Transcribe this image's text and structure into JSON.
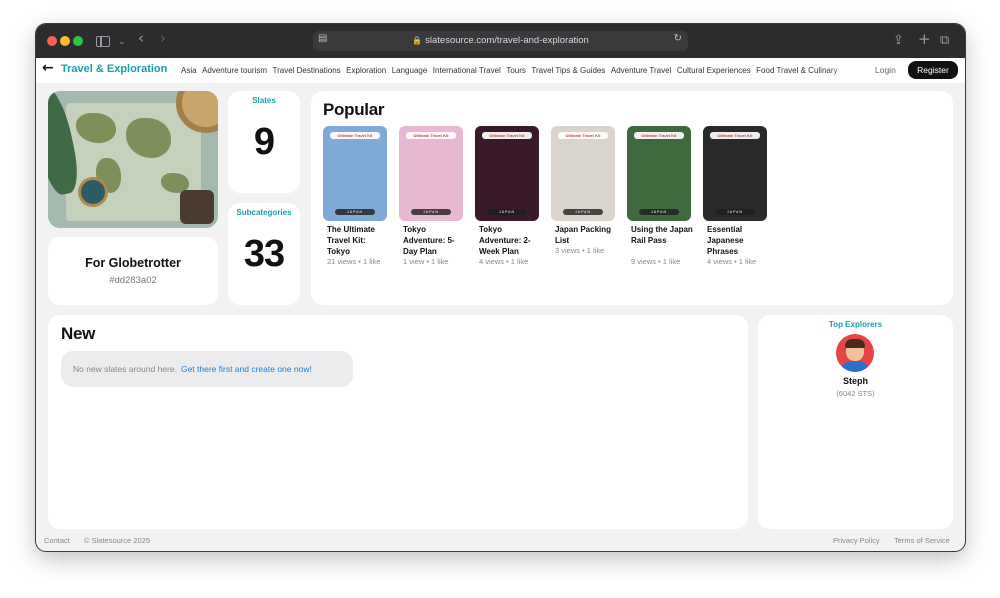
{
  "browser": {
    "url": "slatesource.com/travel-and-exploration"
  },
  "header": {
    "title": "Travel & Exploration",
    "subcategories": [
      "Asia",
      "Adventure tourism",
      "Travel Destinations",
      "Exploration",
      "Language",
      "International Travel",
      "Tours",
      "Travel Tips & Guides",
      "Adventure Travel",
      "Cultural Experiences",
      "Food Travel & Culinary"
    ],
    "login_label": "Login",
    "register_label": "Register"
  },
  "profile": {
    "name": "For Globetrotter",
    "code": "#dd283a02"
  },
  "stats": {
    "slates_label": "Slates",
    "slates_value": "9",
    "subcategories_label": "Subcategories",
    "subcategories_value": "33"
  },
  "popular": {
    "title": "Popular",
    "items": [
      {
        "title": "The Ultimate Travel Kit: Tokyo",
        "meta": "21 views • 1 like",
        "tag": "Ultimate Travel Kit",
        "footer": "JAPAN",
        "bg": "#7fa9d6"
      },
      {
        "title": "Tokyo Adventure: 5-Day Plan",
        "meta": "1 view • 1 like",
        "tag": "Ultimate Travel Kit",
        "footer": "JAPAN",
        "bg": "#e8b7d2"
      },
      {
        "title": "Tokyo Adventure: 2-Week Plan",
        "meta": "4 views • 1 like",
        "tag": "Ultimate Travel Kit",
        "footer": "JAPAN",
        "bg": "#3a1a2a"
      },
      {
        "title": "Japan Packing List",
        "meta": "3 views • 1 like",
        "tag": "Ultimate Travel Kit",
        "footer": "JAPAN",
        "bg": "#d9d4cc"
      },
      {
        "title": "Using the Japan Rail Pass",
        "meta": "9 views • 1 like",
        "tag": "Ultimate Travel Kit",
        "footer": "JAPAN",
        "bg": "#3f6a3f"
      },
      {
        "title": "Essential Japanese Phrases",
        "meta": "4 views • 1 like",
        "tag": "Ultimate Travel Kit",
        "footer": "JAPAN",
        "bg": "#2a2a2a"
      }
    ]
  },
  "new_section": {
    "title": "New",
    "empty_text": "No new slates around here.",
    "empty_link": "Get there first and create one now!"
  },
  "top_explorers": {
    "label": "Top Explorers",
    "name": "Steph",
    "score": "(6042 STS)"
  },
  "footer": {
    "contact": "Contact",
    "copyright": "© Slatesource 2025",
    "privacy": "Privacy Policy",
    "terms": "Terms of Service"
  }
}
